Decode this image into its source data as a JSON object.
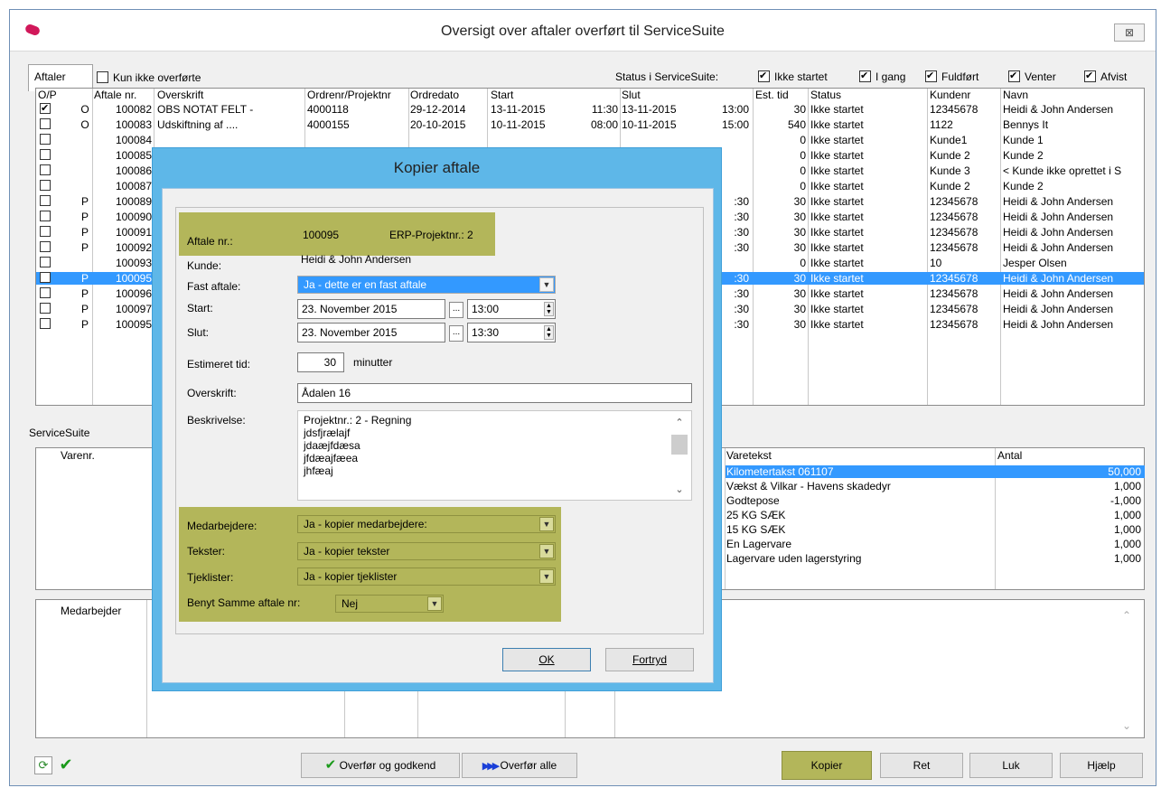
{
  "window": {
    "title": "Oversigt over aftaler overført til ServiceSuite",
    "close_glyph": "⊠"
  },
  "tabs": {
    "aftaler": "Aftaler"
  },
  "filters": {
    "kun_ikke_overforte": "Kun ikke overførte",
    "status_label": "Status i ServiceSuite:",
    "ikke_startet": "Ikke startet",
    "i_gang": "I gang",
    "fuldfort": "Fuldført",
    "venter": "Venter",
    "afvist": "Afvist"
  },
  "grid": {
    "headers": [
      "O/P",
      "Aftale nr.",
      "Overskrift",
      "Ordrenr/Projektnr",
      "Ordredato",
      "Start",
      "Slut",
      "Est. tid",
      "Status",
      "Kundenr",
      "Navn"
    ],
    "rows": [
      {
        "checked": true,
        "op": "O",
        "nr": "100082",
        "overskrift": "OBS NOTAT FELT -",
        "ordre": "4000118",
        "dato": "29-12-2014",
        "start": "13-11-2015",
        "start_t": "11:30",
        "slut": "13-11-2015",
        "slut_t": "13:00",
        "est": "30",
        "status": "Ikke startet",
        "kundenr": "12345678",
        "navn": "Heidi & John Andersen"
      },
      {
        "checked": false,
        "op": "O",
        "nr": "100083",
        "overskrift": "Udskiftning af ....",
        "ordre": "4000155",
        "dato": "20-10-2015",
        "start": "10-11-2015",
        "start_t": "08:00",
        "slut": "10-11-2015",
        "slut_t": "15:00",
        "est": "540",
        "status": "Ikke startet",
        "kundenr": "1122",
        "navn": "Bennys It"
      },
      {
        "checked": false,
        "op": "",
        "nr": "100084",
        "overskrift": "",
        "ordre": "",
        "dato": "",
        "start": "",
        "start_t": "",
        "slut": "",
        "slut_t": "",
        "est": "0",
        "status": "Ikke startet",
        "kundenr": "Kunde1",
        "navn": "Kunde 1"
      },
      {
        "checked": false,
        "op": "",
        "nr": "100085",
        "overskrift": "",
        "ordre": "",
        "dato": "",
        "start": "",
        "start_t": "",
        "slut": "",
        "slut_t": "",
        "est": "0",
        "status": "Ikke startet",
        "kundenr": "Kunde 2",
        "navn": "Kunde 2"
      },
      {
        "checked": false,
        "op": "",
        "nr": "100086",
        "overskrift": "",
        "ordre": "",
        "dato": "",
        "start": "",
        "start_t": "",
        "slut": "",
        "slut_t": "",
        "est": "0",
        "status": "Ikke startet",
        "kundenr": "Kunde 3",
        "navn": "< Kunde ikke oprettet i S"
      },
      {
        "checked": false,
        "op": "",
        "nr": "100087",
        "overskrift": "",
        "ordre": "",
        "dato": "",
        "start": "",
        "start_t": "",
        "slut": "",
        "slut_t": "",
        "est": "0",
        "status": "Ikke startet",
        "kundenr": "Kunde 2",
        "navn": "Kunde 2"
      },
      {
        "checked": false,
        "op": "P",
        "nr": "100089",
        "overskrift": "",
        "ordre": "",
        "dato": "",
        "start": "",
        "start_t": "",
        "slut": "",
        "slut_t": ":30",
        "est": "30",
        "status": "Ikke startet",
        "kundenr": "12345678",
        "navn": "Heidi & John Andersen"
      },
      {
        "checked": false,
        "op": "P",
        "nr": "100090",
        "overskrift": "",
        "ordre": "",
        "dato": "",
        "start": "",
        "start_t": "",
        "slut": "",
        "slut_t": ":30",
        "est": "30",
        "status": "Ikke startet",
        "kundenr": "12345678",
        "navn": "Heidi & John Andersen"
      },
      {
        "checked": false,
        "op": "P",
        "nr": "100091",
        "overskrift": "",
        "ordre": "",
        "dato": "",
        "start": "",
        "start_t": "",
        "slut": "",
        "slut_t": ":30",
        "est": "30",
        "status": "Ikke startet",
        "kundenr": "12345678",
        "navn": "Heidi & John Andersen"
      },
      {
        "checked": false,
        "op": "P",
        "nr": "100092",
        "overskrift": "",
        "ordre": "",
        "dato": "",
        "start": "",
        "start_t": "",
        "slut": "",
        "slut_t": ":30",
        "est": "30",
        "status": "Ikke startet",
        "kundenr": "12345678",
        "navn": "Heidi & John Andersen"
      },
      {
        "checked": false,
        "op": "",
        "nr": "100093",
        "overskrift": "",
        "ordre": "",
        "dato": "",
        "start": "",
        "start_t": "",
        "slut": "",
        "slut_t": "",
        "est": "0",
        "status": "Ikke startet",
        "kundenr": "10",
        "navn": "Jesper Olsen"
      },
      {
        "checked": false,
        "op": "P",
        "nr": "100095",
        "overskrift": "",
        "ordre": "",
        "dato": "",
        "start": "",
        "start_t": "",
        "slut": "",
        "slut_t": ":30",
        "est": "30",
        "status": "Ikke startet",
        "kundenr": "12345678",
        "navn": "Heidi & John Andersen",
        "selected": true
      },
      {
        "checked": false,
        "op": "P",
        "nr": "100096",
        "overskrift": "",
        "ordre": "",
        "dato": "",
        "start": "",
        "start_t": "",
        "slut": "",
        "slut_t": ":30",
        "est": "30",
        "status": "Ikke startet",
        "kundenr": "12345678",
        "navn": "Heidi & John Andersen"
      },
      {
        "checked": false,
        "op": "P",
        "nr": "100097",
        "overskrift": "",
        "ordre": "",
        "dato": "",
        "start": "",
        "start_t": "",
        "slut": "",
        "slut_t": ":30",
        "est": "30",
        "status": "Ikke startet",
        "kundenr": "12345678",
        "navn": "Heidi & John Andersen"
      },
      {
        "checked": false,
        "op": "P",
        "nr": "100095",
        "overskrift": "",
        "ordre": "",
        "dato": "",
        "start": "",
        "start_t": "",
        "slut": "",
        "slut_t": ":30",
        "est": "30",
        "status": "Ikke startet",
        "kundenr": "12345678",
        "navn": "Heidi & John Andersen"
      }
    ]
  },
  "servicesuite": {
    "label": "ServiceSuite",
    "varenr_header": "Varenr.",
    "varetekst_header": "Varetekst",
    "antal_header": "Antal",
    "items": [
      {
        "tekst": "Kilometertakst 061107",
        "antal": "50,000",
        "selected": true
      },
      {
        "tekst": "Vækst & Vilkar - Havens skadedyr",
        "antal": "1,000"
      },
      {
        "tekst": "Godtepose",
        "antal": "-1,000"
      },
      {
        "tekst": "25 KG SÆK",
        "antal": "1,000"
      },
      {
        "tekst": "15 KG SÆK",
        "antal": "1,000"
      },
      {
        "tekst": "En Lagervare",
        "antal": "1,000"
      },
      {
        "tekst": "Lagervare uden lagerstyring",
        "antal": "1,000"
      }
    ],
    "medarbejder_header": "Medarbejder"
  },
  "bottom": {
    "overfor_godkend": "Overfør og godkend",
    "overfor_alle": "Overfør alle",
    "kopier": "Kopier",
    "ret": "Ret",
    "luk": "Luk",
    "hjaelp": "Hjælp"
  },
  "dialog": {
    "title": "Kopier aftale",
    "aftale_nr_label": "Aftale nr.:",
    "aftale_nr_value": "100095",
    "erp_label": "ERP-Projektnr.: 2",
    "kunde_label": "Kunde:",
    "kunde_value": "Heidi & John Andersen",
    "fast_label": "Fast aftale:",
    "fast_value": "Ja - dette er en fast aftale",
    "start_label": "Start:",
    "start_date": "23. November 2015",
    "start_time": "13:00",
    "slut_label": "Slut:",
    "slut_date": "23. November 2015",
    "slut_time": "13:30",
    "est_label": "Estimeret tid:",
    "est_value": "30",
    "est_unit": "minutter",
    "overskrift_label": "Overskrift:",
    "overskrift_value": "Ådalen 16",
    "beskrivelse_label": "Beskrivelse:",
    "beskrivelse_lines": [
      "Projektnr.: 2 - Regning",
      "jdsfjrælajf",
      "jdaæjfdæsa",
      "jfdæajfæea",
      "jhfæaj"
    ],
    "medarbejdere_label": "Medarbejdere:",
    "medarbejdere_value": "Ja - kopier medarbejdere:",
    "tekster_label": "Tekster:",
    "tekster_value": "Ja - kopier tekster",
    "tjeklister_label": "Tjeklister:",
    "tjeklister_value": "Ja - kopier tjeklister",
    "samme_label": "Benyt Samme aftale nr:",
    "samme_value": "Nej",
    "ok": "OK",
    "fortryd": "Fortryd"
  },
  "colors": {
    "highlight_olive": "#b3b65a",
    "selection_blue": "#3399ff",
    "dialog_frame": "#5eb7e8"
  }
}
